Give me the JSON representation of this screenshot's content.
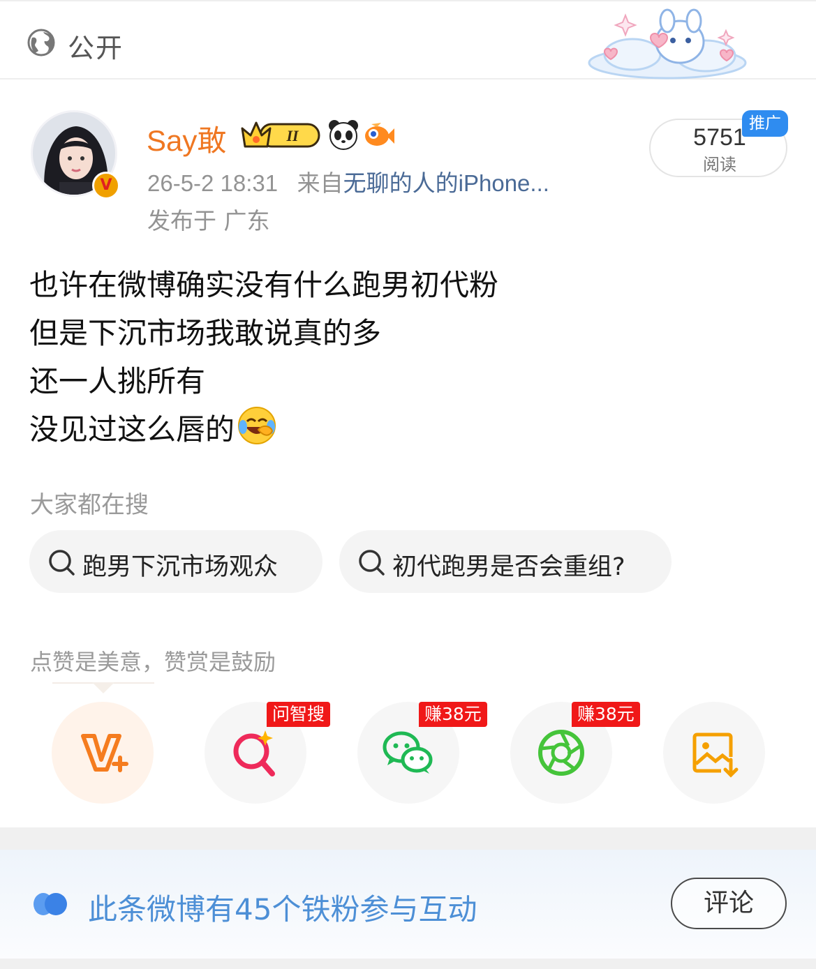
{
  "topbar": {
    "visibility_label": "公开"
  },
  "header": {
    "username": "Say敢",
    "timestamp": "26-5-2 18:31",
    "from_prefix": "来自",
    "source": "无聊的人的iPhone...",
    "location": "发布于 广东",
    "reads_count": "5751",
    "reads_label": "阅读",
    "promo_badge": "推广",
    "verified_badge": "V",
    "level_badge": "II"
  },
  "post": {
    "lines": [
      "也许在微博确实没有什么跑男初代粉",
      "但是下沉市场我敢说真的多",
      "还一人挑所有",
      "没见过这么唇的"
    ]
  },
  "search": {
    "title": "大家都在搜",
    "chips": [
      "跑男下沉市场观众",
      "初代跑男是否会重组?"
    ]
  },
  "reward": {
    "text": "点赞是美意，赞赏是鼓励"
  },
  "share": {
    "tags": [
      "问智搜",
      "赚38元",
      "赚38元"
    ],
    "icons": [
      "vplus-icon",
      "ai-search-icon",
      "wechat-icon",
      "moments-icon",
      "save-image-icon"
    ]
  },
  "fan_bar": {
    "text": "此条微博有45个铁粉参与互动",
    "comment_button": "评论"
  },
  "colors": {
    "username": "#ef7722",
    "link": "#4a6a96",
    "promo": "#2f8cf0",
    "tag_red": "#f01818",
    "fan_text": "#4d8fd6"
  }
}
